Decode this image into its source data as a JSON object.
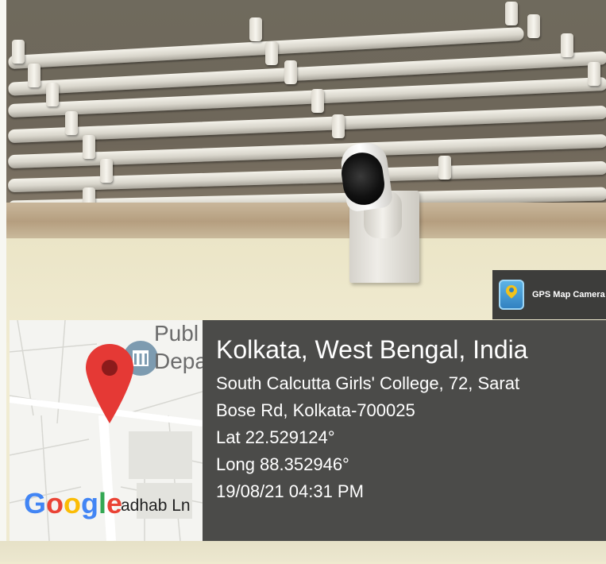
{
  "badge": {
    "label": "GPS Map Camera",
    "icon": "gps-map-camera-icon"
  },
  "map": {
    "place_label_line1": "Publ",
    "place_label_line2": "Depa",
    "street_label": "adhab Ln",
    "logo_text": "Google",
    "pin_color": "#e53935",
    "pin_icon": "map-pin-icon",
    "poi_icon": "government-building-icon"
  },
  "location": {
    "title": "Kolkata, West Bengal, India",
    "address_line1": "South Calcutta Girls' College, 72, Sarat",
    "address_line2": "Bose Rd, Kolkata-700025",
    "latitude": "Lat 22.529124°",
    "longitude": "Long 88.352946°",
    "datetime": "19/08/21 04:31 PM"
  },
  "colors": {
    "panel_background": "#4b4b49",
    "text": "#ffffff"
  }
}
